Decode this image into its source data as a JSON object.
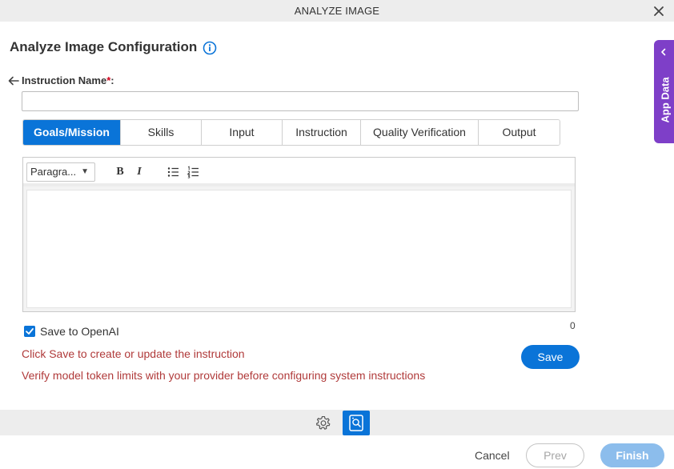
{
  "window": {
    "title": "ANALYZE IMAGE",
    "close_icon": "close-icon"
  },
  "page": {
    "heading": "Analyze Image Configuration",
    "info_icon": "info-icon"
  },
  "instruction_name": {
    "label": "Instruction Name",
    "required_marker": "*",
    "suffix": ":",
    "value": "",
    "back_icon": "arrow-left-icon"
  },
  "tabs": [
    {
      "label": "Goals/Mission",
      "active": true
    },
    {
      "label": "Skills",
      "active": false
    },
    {
      "label": "Input",
      "active": false
    },
    {
      "label": "Instruction",
      "active": false
    },
    {
      "label": "Quality Verification",
      "active": false
    },
    {
      "label": "Output",
      "active": false
    }
  ],
  "editor": {
    "format_selected": "Paragra...",
    "bold_label": "B",
    "italic_label": "I",
    "bullet_list_icon": "bullet-list-icon",
    "numbered_list_icon": "numbered-list-icon",
    "content": "",
    "char_count": "0"
  },
  "save_to_openai": {
    "label": "Save to OpenAI",
    "checked": true
  },
  "messages": {
    "save_hint": "Click Save to create or update the instruction",
    "token_warning": "Verify model token limits with your provider before configuring system instructions"
  },
  "buttons": {
    "save": "Save",
    "cancel": "Cancel",
    "prev": "Prev",
    "finish": "Finish"
  },
  "app_data_panel": {
    "label": "App Data"
  },
  "colors": {
    "primary": "#0a74d8",
    "app_data": "#7e3fc8",
    "message": "#b03a3a",
    "finish_disabled": "#8cbdec"
  }
}
